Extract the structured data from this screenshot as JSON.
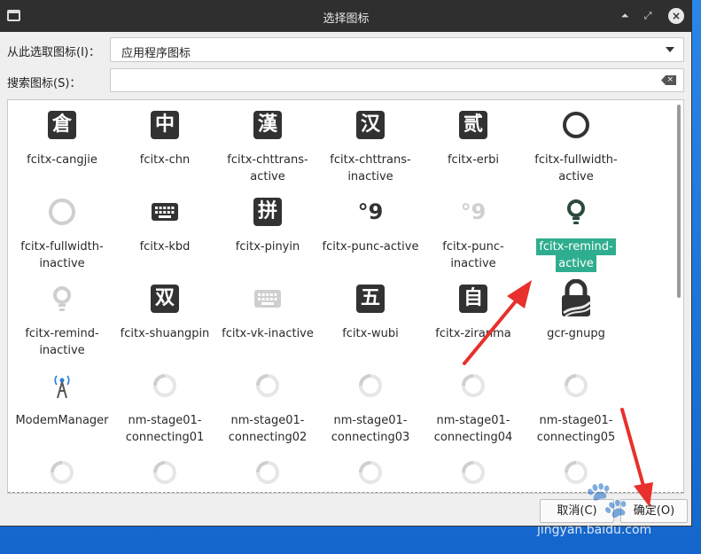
{
  "window": {
    "title": "选择图标"
  },
  "source": {
    "label": "从此选取图标(I)：",
    "value": "应用程序图标"
  },
  "search": {
    "label": "搜索图标(S)：",
    "value": ""
  },
  "icons": [
    {
      "name": "fcitx-cangjie",
      "glyph": "倉"
    },
    {
      "name": "fcitx-chn",
      "glyph": "中"
    },
    {
      "name": "fcitx-chttrans-active",
      "glyph": "漢"
    },
    {
      "name": "fcitx-chttrans-inactive",
      "glyph": "汉"
    },
    {
      "name": "fcitx-erbi",
      "glyph": "贰"
    },
    {
      "name": "fcitx-fullwidth-active",
      "glyph": "ring"
    },
    {
      "name": "fcitx-fullwidth-inactive",
      "glyph": "ring-light"
    },
    {
      "name": "fcitx-kbd",
      "glyph": "keyboard"
    },
    {
      "name": "fcitx-pinyin",
      "glyph": "拼"
    },
    {
      "name": "fcitx-punc-active",
      "glyph": "°9"
    },
    {
      "name": "fcitx-punc-inactive",
      "glyph": "°9"
    },
    {
      "name": "fcitx-remind-active",
      "glyph": "bulb",
      "selected": true
    },
    {
      "name": "fcitx-remind-inactive",
      "glyph": "bulb-light"
    },
    {
      "name": "fcitx-shuangpin",
      "glyph": "双"
    },
    {
      "name": "fcitx-vk-inactive",
      "glyph": "keyboard-light"
    },
    {
      "name": "fcitx-wubi",
      "glyph": "五"
    },
    {
      "name": "fcitx-ziranma",
      "glyph": "自"
    },
    {
      "name": "gcr-gnupg",
      "glyph": "lock"
    },
    {
      "name": "ModemManager",
      "glyph": "antenna"
    },
    {
      "name": "nm-stage01-connecting01",
      "glyph": "spinner"
    },
    {
      "name": "nm-stage01-connecting02",
      "glyph": "spinner"
    },
    {
      "name": "nm-stage01-connecting03",
      "glyph": "spinner"
    },
    {
      "name": "nm-stage01-connecting04",
      "glyph": "spinner"
    },
    {
      "name": "nm-stage01-connecting05",
      "glyph": "spinner"
    }
  ],
  "buttons": {
    "cancel": "取消(C)",
    "ok": "确定(O)"
  },
  "watermark": "jingyan.baidu.com",
  "colors": {
    "selection": "#2fae8f",
    "arrow": "#e8302c",
    "titlebar": "#2f2f2f"
  }
}
